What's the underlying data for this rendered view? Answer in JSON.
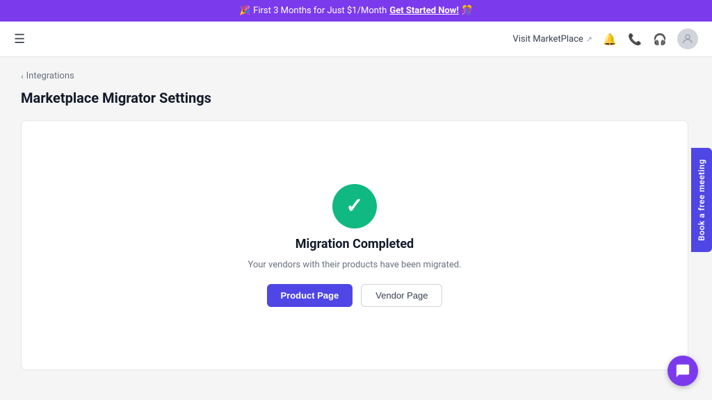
{
  "banner": {
    "emoji_left": "🎉",
    "text": "First 3 Months for Just $1/Month",
    "cta_label": "Get Started Now!",
    "emoji_right": "🎊"
  },
  "header": {
    "marketplace_link_label": "Visit MarketPlace",
    "external_icon": "↗"
  },
  "breadcrumb": {
    "chevron": "‹",
    "label": "Integrations"
  },
  "page_title": "Marketplace Migrator Settings",
  "card": {
    "success_icon": "✓",
    "migration_title": "Migration Completed",
    "migration_desc": "Your vendors with their products have been migrated.",
    "product_page_label": "Product Page",
    "vendor_page_label": "Vendor Page"
  },
  "side_button": {
    "label": "Book a free meeting"
  },
  "chat_bubble": {
    "icon": "💬"
  }
}
